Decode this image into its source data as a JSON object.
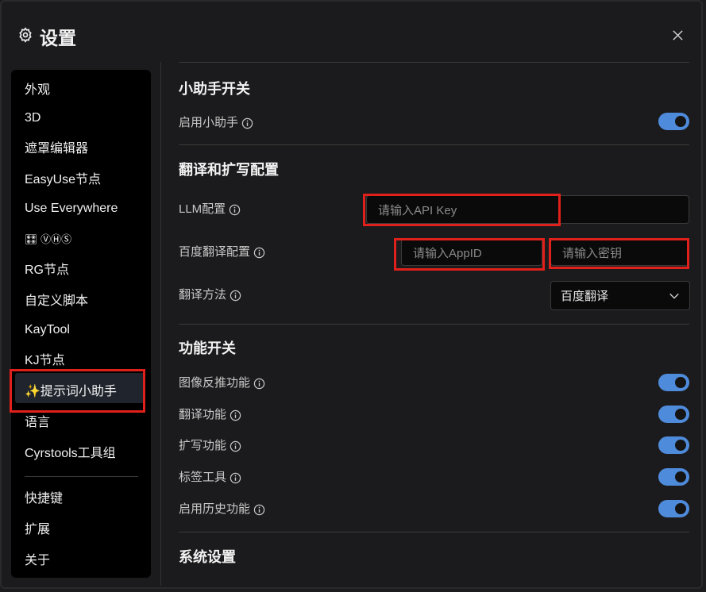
{
  "dialog": {
    "title": "设置",
    "title_icon": "gear-icon",
    "close_icon": "close-icon"
  },
  "sidebar": {
    "items": [
      {
        "label": "外观"
      },
      {
        "label": "3D"
      },
      {
        "label": "遮罩编辑器"
      },
      {
        "label": "EasyUse节点"
      },
      {
        "label": "Use Everywhere"
      },
      {
        "label": "🎛 ⓋⒽⓈ"
      },
      {
        "label": "RG节点"
      },
      {
        "label": "自定义脚本"
      },
      {
        "label": "KayTool"
      },
      {
        "label": "KJ节点"
      },
      {
        "label": "✨提示词小助手",
        "active": true
      },
      {
        "label": "语言"
      },
      {
        "label": "Cyrstools工具组"
      }
    ],
    "footer_items": [
      {
        "label": "快捷键"
      },
      {
        "label": "扩展"
      },
      {
        "label": "关于"
      }
    ]
  },
  "sections": {
    "assistant": {
      "title": "小助手开关",
      "enable_label": "启用小助手",
      "enable_on": true
    },
    "translate": {
      "title": "翻译和扩写配置",
      "llm_label": "LLM配置",
      "llm_placeholder": "请输入API Key",
      "baidu_label": "百度翻译配置",
      "appid_placeholder": "请输入AppID",
      "secret_placeholder": "请输入密钥",
      "method_label": "翻译方法",
      "method_value": "百度翻译"
    },
    "features": {
      "title": "功能开关",
      "items": [
        {
          "label": "图像反推功能",
          "on": true
        },
        {
          "label": "翻译功能",
          "on": true
        },
        {
          "label": "扩写功能",
          "on": true
        },
        {
          "label": "标签工具",
          "on": true
        },
        {
          "label": "启用历史功能",
          "on": true
        }
      ]
    },
    "system": {
      "title": "系统设置"
    }
  },
  "colors": {
    "toggle_on": "#4f8bdb",
    "highlight_box": "#e0201a",
    "background": "#1b1b1d"
  }
}
